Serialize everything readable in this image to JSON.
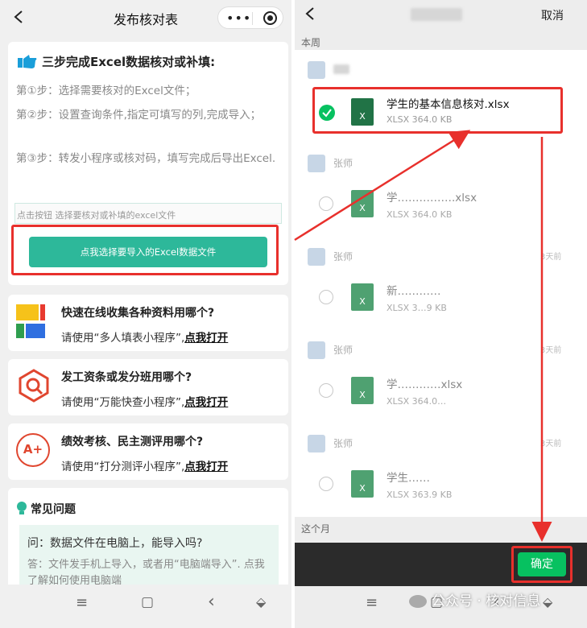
{
  "left": {
    "header": {
      "title": "发布核对表"
    },
    "guide": {
      "heading": "三步完成Excel数据核对或补填:",
      "step1": "第①步：选择需要核对的Excel文件；",
      "step2": "第②步：设置查询条件,指定可填写的列,完成导入；",
      "step3": "第③步：转发小程序或核对码，填写完成后导出Excel.",
      "input_placeholder": "点击按钮 选择要核对或补填的excel文件",
      "button": "点我选择要导入的Excel数据文件"
    },
    "promos": [
      {
        "question": "快速在线收集各种资料用哪个?",
        "prefix": "请使用",
        "app": "“多人填表小程序”,",
        "link": "点我打开"
      },
      {
        "question": "发工资条或发分班用哪个?",
        "prefix": "请使用",
        "app": "“万能快查小程序”,",
        "link": "点我打开"
      },
      {
        "question": "绩效考核、民主测评用哪个?",
        "prefix": "请使用",
        "app": "“打分测评小程序”,",
        "link": "点我打开"
      }
    ],
    "faq": {
      "title": "常见问题",
      "q": "问：数据文件在电脑上，能导入吗?",
      "a": "答：文件发手机上导入，或者用“电脑端导入”. 点我了解如何使用电脑端"
    },
    "promo_badge": "A+",
    "nav": [
      "≡",
      "▢",
      "‹",
      "⬙"
    ]
  },
  "right": {
    "header": {
      "cancel": "取消"
    },
    "section_week": "本周",
    "section_month": "这个月",
    "groups": [
      {
        "sender": "",
        "file": "学生的基本信息核对.xlsx",
        "meta": "XLSX 364.0 KB",
        "selected": true
      },
      {
        "sender": "张师",
        "file": "学…………….xlsx",
        "meta": "XLSX 364.0 KB",
        "selected": false
      },
      {
        "sender": "张师",
        "file": "新…………",
        "meta": "XLSX 3…9 KB",
        "selected": false
      },
      {
        "sender": "张师",
        "file": "学…………xlsx",
        "meta": "XLSX 364.0…",
        "selected": false
      },
      {
        "sender": "张师",
        "file": "学生……",
        "meta": "XLSX 363.9 KB",
        "selected": false
      }
    ],
    "time_labels": [
      "3天前",
      "3天前",
      "3天前"
    ],
    "file_icon_letter": "X",
    "confirm": "确定",
    "nav": [
      "≡",
      "▢",
      "‹",
      "⬙"
    ]
  },
  "watermark": "公众号 · 核对信息",
  "colors": {
    "accent_green": "#2db89a",
    "excel_green": "#217346",
    "confirm_green": "#07c160",
    "red": "#e8302c"
  }
}
